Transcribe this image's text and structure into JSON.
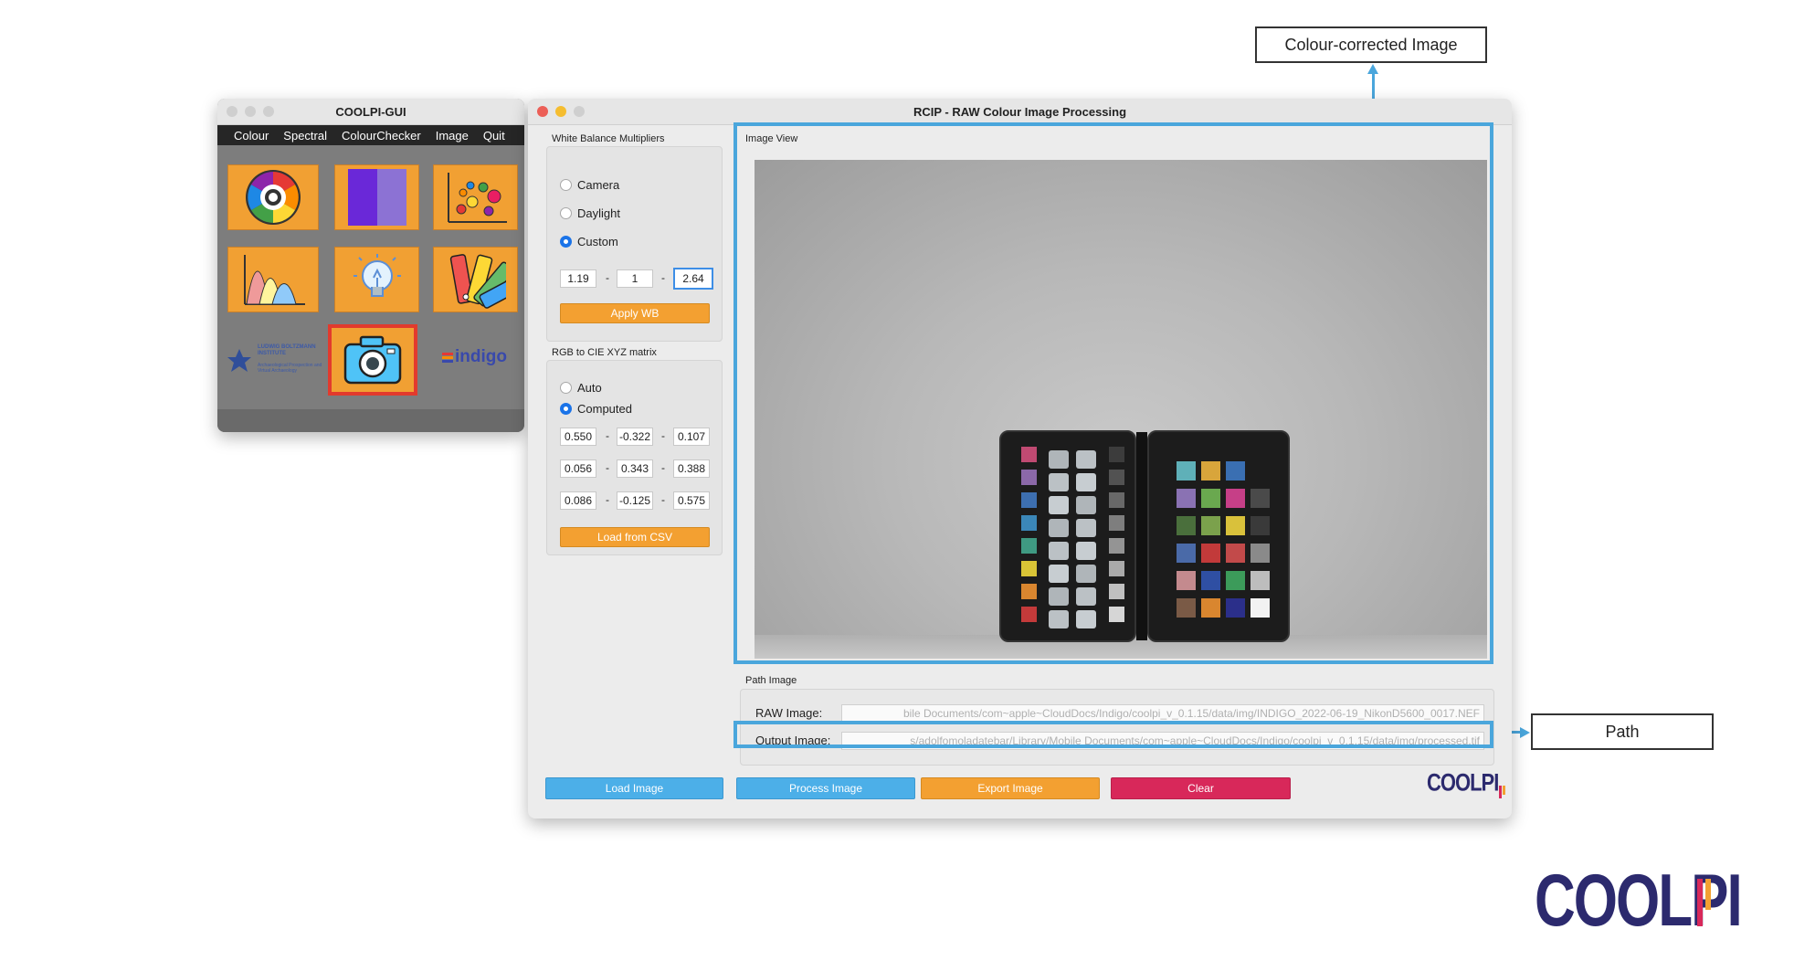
{
  "callouts": {
    "colour_corrected": "Colour-corrected Image",
    "path": "Path"
  },
  "coolpi_gui": {
    "title": "COOLPI-GUI",
    "menu": [
      "Colour",
      "Spectral",
      "ColourChecker",
      "Image",
      "Quit"
    ],
    "logos": {
      "lbi": "LUDWIG BOLTZMANN INSTITUTE",
      "lbi_sub": "Archaeological Prospection and Virtual Archaeology",
      "indigo": "indigo"
    }
  },
  "rcip": {
    "title": "RCIP - RAW Colour Image Processing",
    "wb": {
      "group_label": "White Balance Multipliers",
      "options": [
        "Camera",
        "Daylight",
        "Custom"
      ],
      "selected": "Custom",
      "multipliers": [
        "1.19",
        "1",
        "2.64"
      ],
      "apply_button": "Apply WB"
    },
    "matrix": {
      "group_label": "RGB to CIE XYZ matrix",
      "options": [
        "Auto",
        "Computed"
      ],
      "selected": "Computed",
      "rows": [
        [
          "0.550",
          "-0.322",
          "0.107"
        ],
        [
          "0.056",
          "0.343",
          "0.388"
        ],
        [
          "0.086",
          "-0.125",
          "0.575"
        ]
      ],
      "load_button": "Load from CSV"
    },
    "image_view": {
      "label": "Image View"
    },
    "path_image": {
      "label": "Path Image",
      "raw_label": "RAW Image:",
      "raw_value": "bile Documents/com~apple~CloudDocs/Indigo/coolpi_v_0.1.15/data/img/INDIGO_2022-06-19_NikonD5600_0017.NEF",
      "output_label": "Output Image:",
      "output_value": "s/adolfomoladatebar/Library/Mobile Documents/com~apple~CloudDocs/Indigo/coolpi_v_0.1.15/data/img/processed.tif"
    },
    "buttons": {
      "load": "Load Image",
      "process": "Process Image",
      "export": "Export Image",
      "clear": "Clear"
    },
    "logo_text": "COOLPI"
  },
  "brand_logo": "COOLPI",
  "colors": {
    "accent_blue": "#4aa6dc",
    "orange": "#f3a031",
    "red": "#d8285a",
    "navy": "#2c2a6e"
  },
  "colorchecker": {
    "left_patches": [
      "#c04a72",
      "#8b68a8",
      "#3d6fb0",
      "#3b87b8",
      "#3f9a82",
      "#d9c436",
      "#d9862f",
      "#c43a3a"
    ],
    "right_rows": [
      [
        "#5fb0b8",
        "#d8a53b",
        "#3a6fb2",
        ""
      ],
      [
        "#8a72b3",
        "#6aa84f",
        "#c63f87",
        "#4a4a4a"
      ],
      [
        "#4a6f3c",
        "#7ba14c",
        "#d9c13b",
        "#3a3a3a"
      ],
      [
        "#4a6aa8",
        "#c23a3a",
        "#c24a4a",
        "#8a8a8a"
      ],
      [
        "#c48a8e",
        "#2f4fa3",
        "#3c9b5a",
        "#bdbdbd"
      ],
      [
        "#7a5a46",
        "#d9862f",
        "#2b2f8a",
        "#f2f2f2"
      ]
    ]
  }
}
